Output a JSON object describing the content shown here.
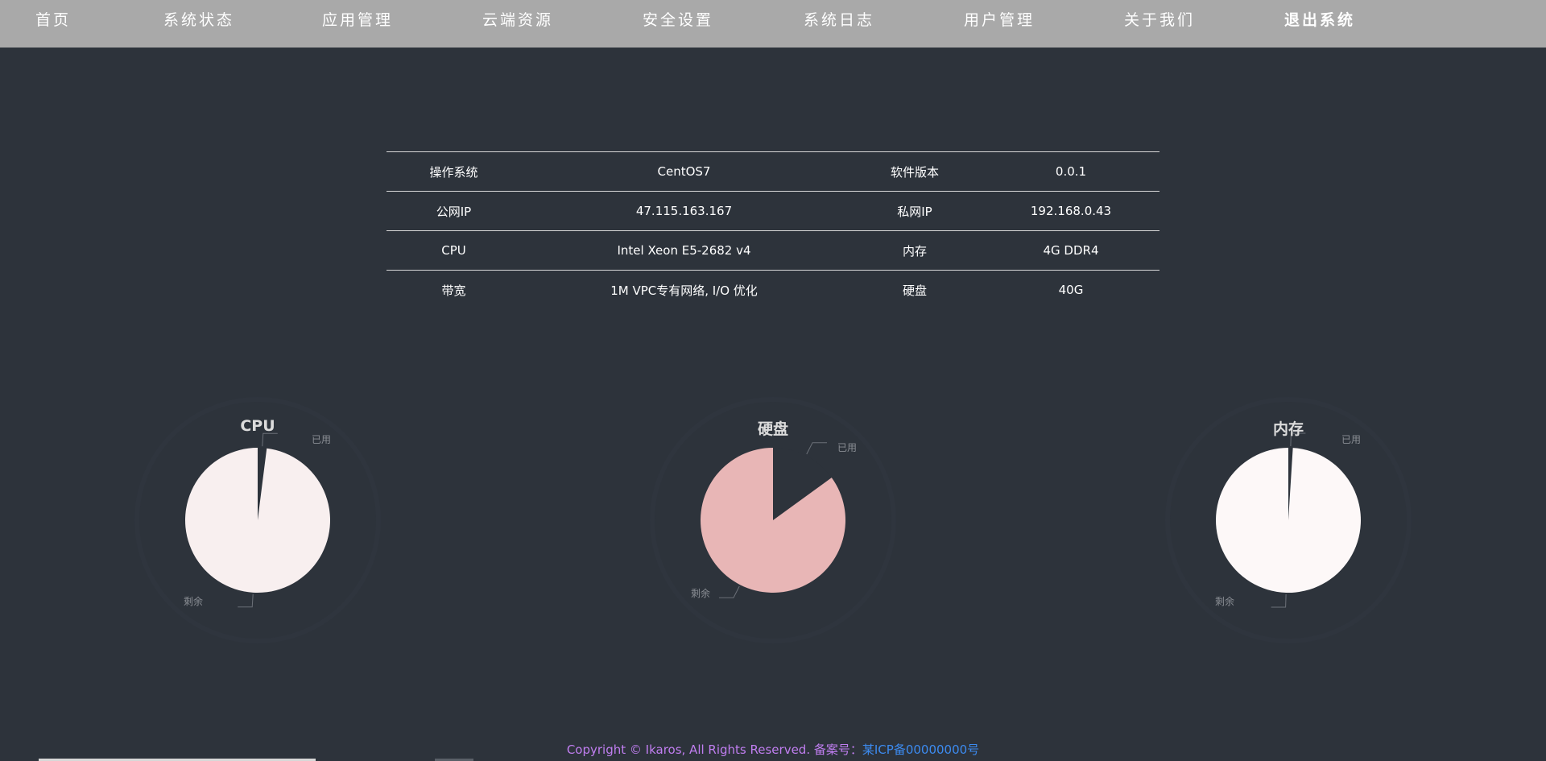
{
  "nav": {
    "items": [
      "首页",
      "系统状态",
      "应用管理",
      "云端资源",
      "安全设置",
      "系统日志",
      "用户管理",
      "关于我们"
    ],
    "logout": "退出系统"
  },
  "server_info": {
    "rows": [
      {
        "label1": "操作系统",
        "value1": "CentOS7",
        "label2": "软件版本",
        "value2": "0.0.1"
      },
      {
        "label1": "公网IP",
        "value1": "47.115.163.167",
        "label2": "私网IP",
        "value2": "192.168.0.43"
      },
      {
        "label1": "CPU",
        "value1": "Intel Xeon E5-2682 v4",
        "label2": "内存",
        "value2": "4G DDR4"
      },
      {
        "label1": "带宽",
        "value1": "1M VPC专有网络, I/O 优化",
        "label2": "硬盘",
        "value2": "40G"
      }
    ]
  },
  "chart_data": [
    {
      "type": "pie",
      "title": "CPU",
      "categories": [
        "已用",
        "剩余"
      ],
      "values": [
        2,
        98
      ],
      "colors": [
        "#2d333b",
        "#f8efef"
      ]
    },
    {
      "type": "pie",
      "title": "硬盘",
      "categories": [
        "已用",
        "剩余"
      ],
      "values": [
        15,
        85
      ],
      "colors": [
        "#2d333b",
        "#e8b6b6"
      ]
    },
    {
      "type": "pie",
      "title": "内存",
      "categories": [
        "已用",
        "剩余"
      ],
      "values": [
        1,
        99
      ],
      "colors": [
        "#2d333b",
        "#fdf8f8"
      ]
    }
  ],
  "footer": {
    "copyright": "Copyright © Ikaros, All Rights Reserved. 备案号：",
    "icp": "某ICP备00000000号"
  }
}
